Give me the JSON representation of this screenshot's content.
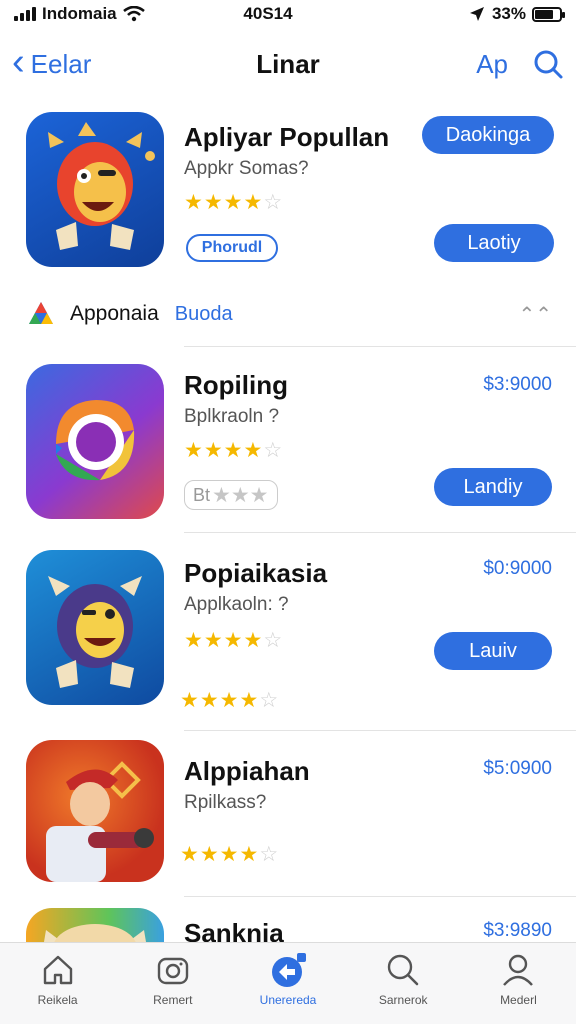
{
  "status_bar": {
    "carrier": "Indomaia",
    "time": "40S14",
    "battery": "33%",
    "battery_level": 0.75
  },
  "nav": {
    "back_label": "Eelar",
    "title": "Linar",
    "right_label": "Aр",
    "icons": {
      "back": "chevron-left-icon",
      "search": "search-icon"
    }
  },
  "featured": {
    "name": "Apliyar Popullan",
    "subtitle": "Appkr Somas?",
    "rating": 4,
    "badge_label": "Phorudl",
    "button_top_label": "Daokinga",
    "button_label": "Laotiy"
  },
  "section": {
    "name": "Apponaia",
    "link": "Buoda",
    "icons": {
      "logo": "triangle-logo-icon",
      "chevron": "double-chevron-icon"
    }
  },
  "apps": [
    {
      "name": "Ropiling",
      "subtitle": "Bplkraoln ?",
      "price": "$3:9000",
      "rating": 4,
      "button_label": "Landiy",
      "chip_label": "Bt",
      "chip_rating": 3
    },
    {
      "name": "Popiaikasia",
      "subtitle": "Applkaoln: ?",
      "price": "$0:9000",
      "rating": 4,
      "button_label": "Lauiv",
      "extra_rating": 4
    },
    {
      "name": "Alppiahan",
      "subtitle": "Rpilkass?",
      "price": "$5:0900",
      "rating": 4
    },
    {
      "name": "Sanknia",
      "price": "$3:9890"
    }
  ],
  "tab_bar": {
    "tabs": [
      {
        "label": "Reikela",
        "icon": "home-icon"
      },
      {
        "label": "Remert",
        "icon": "camera-icon"
      },
      {
        "label": "Unerereda",
        "icon": "app-store-icon"
      },
      {
        "label": "Sarnerok",
        "icon": "search-icon"
      },
      {
        "label": "Mederl",
        "icon": "profile-icon"
      }
    ],
    "active_index": 2
  },
  "colors": {
    "accent": "#2f6fe0",
    "star": "#f5b800"
  }
}
